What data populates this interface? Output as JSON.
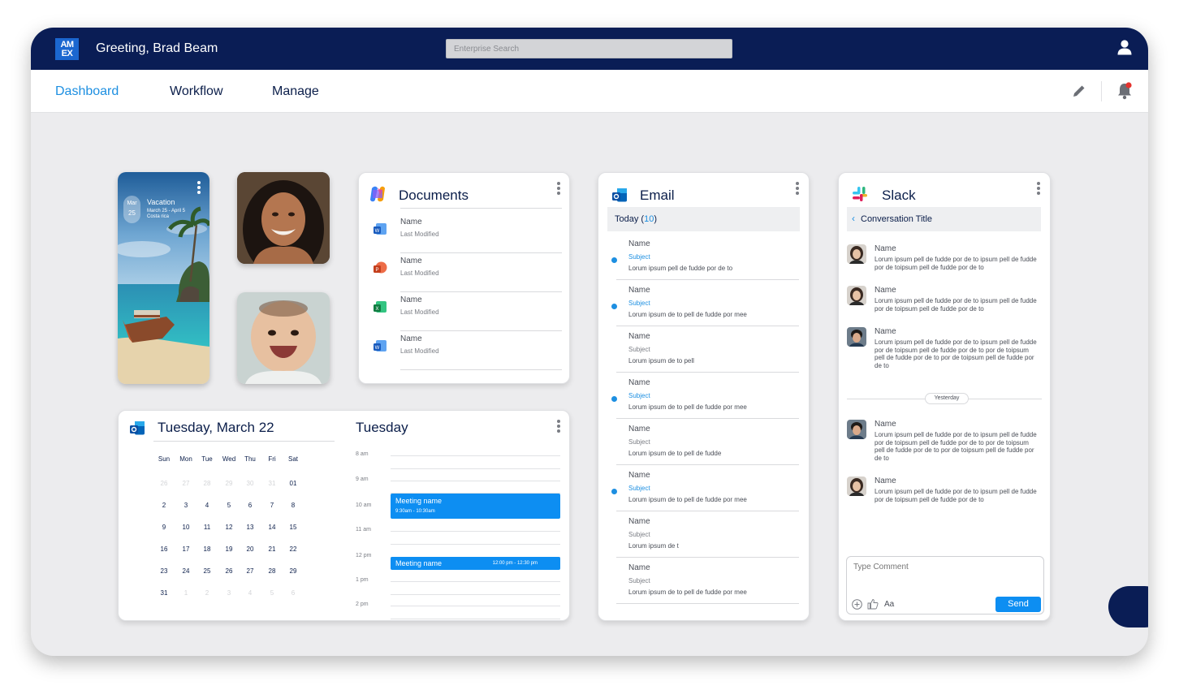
{
  "header": {
    "logo_text_top": "AM",
    "logo_text_bottom": "EX",
    "greeting": "Greeting, Brad Beam",
    "search_placeholder": "Enterprise Search",
    "user_icon": "user-icon"
  },
  "nav": {
    "items": [
      {
        "label": "Dashboard",
        "active": true
      },
      {
        "label": "Workflow",
        "active": false
      },
      {
        "label": "Manage",
        "active": false
      }
    ],
    "edit_icon": "pencil-icon",
    "notification_icon": "bell-icon",
    "notification_color": "#e5322d"
  },
  "vacation": {
    "month": "Mar",
    "day": "25",
    "title": "Vacation",
    "dates": "March 25 - April 5",
    "location": "Costa rica"
  },
  "documents": {
    "title": "Documents",
    "items": [
      {
        "name": "Name",
        "modified": "Last Modified",
        "icon": "word-icon"
      },
      {
        "name": "Name",
        "modified": "Last Modified",
        "icon": "powerpoint-icon"
      },
      {
        "name": "Name",
        "modified": "Last Modified",
        "icon": "excel-icon"
      },
      {
        "name": "Name",
        "modified": "Last Modified",
        "icon": "word-icon"
      }
    ]
  },
  "email": {
    "title": "Email",
    "today_label": "Today (",
    "today_count": "10",
    "today_close": ")",
    "items": [
      {
        "name": "Name",
        "subject": "Subject",
        "preview": "Lorum ipsum pell de fudde por de to",
        "unread": true
      },
      {
        "name": "Name",
        "subject": "Subject",
        "preview": "Lorum ipsum de to pell de fudde por mee",
        "unread": true
      },
      {
        "name": "Name",
        "subject": "Subject",
        "preview": "Lorum ipsum de to pell",
        "unread": false
      },
      {
        "name": "Name",
        "subject": "Subject",
        "preview": "Lorum ipsum de to pell de fudde por mee",
        "unread": true
      },
      {
        "name": "Name",
        "subject": "Subject",
        "preview": "Lorum ipsum de to pell de fudde",
        "unread": false
      },
      {
        "name": "Name",
        "subject": "Subject",
        "preview": "Lorum ipsum de to pell de fudde por mee",
        "unread": true
      },
      {
        "name": "Name",
        "subject": "Subject",
        "preview": "Lorum ipsum de t",
        "unread": false
      },
      {
        "name": "Name",
        "subject": "Subject",
        "preview": "Lorum ipsum de to pell de fudde por mee",
        "unread": false
      }
    ]
  },
  "slack": {
    "title": "Slack",
    "conversation_title": "Conversation Title",
    "divider_label": "Yesterday",
    "messages": [
      {
        "name": "Name",
        "text": "Lorum ipsum pell de fudde por de to ipsum pell de fudde por de toipsum pell de fudde por de to"
      },
      {
        "name": "Name",
        "text": "Lorum ipsum pell de fudde por de to ipsum pell de fudde por de toipsum pell de fudde por de to"
      },
      {
        "name": "Name",
        "text": "Lorum ipsum pell de fudde por de to ipsum pell de fudde por de toipsum pell de fudde por de to por de toipsum pell de fudde por de to  por de toipsum pell de fudde por de to"
      },
      {
        "name": "Name",
        "text": "Lorum ipsum pell de fudde por de to ipsum pell de fudde por de toipsum pell de fudde por de to por de toipsum pell de fudde por de to  por de toipsum pell de fudde por de to"
      },
      {
        "name": "Name",
        "text": "Lorum ipsum pell de fudde por de to ipsum pell de fudde por de toipsum pell de fudde por de to"
      }
    ],
    "comment_placeholder": "Type Comment",
    "format_label": "Aa",
    "send_label": "Send"
  },
  "calendar": {
    "title": "Tuesday, March 22",
    "weekdays": [
      "Sun",
      "Mon",
      "Tue",
      "Wed",
      "Thu",
      "Fri",
      "Sat"
    ],
    "weeks": [
      [
        {
          "d": "26",
          "muted": true
        },
        {
          "d": "27",
          "muted": true
        },
        {
          "d": "28",
          "muted": true
        },
        {
          "d": "29",
          "muted": true
        },
        {
          "d": "30",
          "muted": true
        },
        {
          "d": "31",
          "muted": true
        },
        {
          "d": "01",
          "muted": false
        }
      ],
      [
        {
          "d": "2",
          "muted": false
        },
        {
          "d": "3",
          "muted": false
        },
        {
          "d": "4",
          "muted": false
        },
        {
          "d": "5",
          "muted": false
        },
        {
          "d": "6",
          "muted": false
        },
        {
          "d": "7",
          "muted": false
        },
        {
          "d": "8",
          "muted": false
        }
      ],
      [
        {
          "d": "9",
          "muted": false
        },
        {
          "d": "10",
          "muted": false
        },
        {
          "d": "11",
          "muted": false
        },
        {
          "d": "12",
          "muted": false
        },
        {
          "d": "13",
          "muted": false
        },
        {
          "d": "14",
          "muted": false
        },
        {
          "d": "15",
          "muted": false
        }
      ],
      [
        {
          "d": "16",
          "muted": false
        },
        {
          "d": "17",
          "muted": false
        },
        {
          "d": "18",
          "muted": false
        },
        {
          "d": "19",
          "muted": false
        },
        {
          "d": "20",
          "muted": false
        },
        {
          "d": "21",
          "muted": false
        },
        {
          "d": "22",
          "muted": false
        }
      ],
      [
        {
          "d": "23",
          "muted": false
        },
        {
          "d": "24",
          "muted": false
        },
        {
          "d": "25",
          "muted": false
        },
        {
          "d": "26",
          "muted": false
        },
        {
          "d": "27",
          "muted": false
        },
        {
          "d": "28",
          "muted": false
        },
        {
          "d": "29",
          "muted": false
        }
      ],
      [
        {
          "d": "31",
          "muted": false
        },
        {
          "d": "1",
          "muted": true
        },
        {
          "d": "2",
          "muted": true
        },
        {
          "d": "3",
          "muted": true
        },
        {
          "d": "4",
          "muted": true
        },
        {
          "d": "5",
          "muted": true
        },
        {
          "d": "6",
          "muted": true
        }
      ]
    ],
    "day_title": "Tuesday",
    "times": [
      "8 am",
      "9 am",
      "10 am",
      "11 am",
      "12 pm",
      "1 pm",
      "2 pm"
    ],
    "events": [
      {
        "name": "Meeting name",
        "time": "9:30am - 10:30am"
      },
      {
        "name": "Meeting name",
        "time": "12:00 pm - 12:30 pm"
      }
    ]
  },
  "colors": {
    "navy": "#0a1d55",
    "accent": "#1d8fe1",
    "event": "#0d8ef2",
    "background": "#ececee"
  }
}
